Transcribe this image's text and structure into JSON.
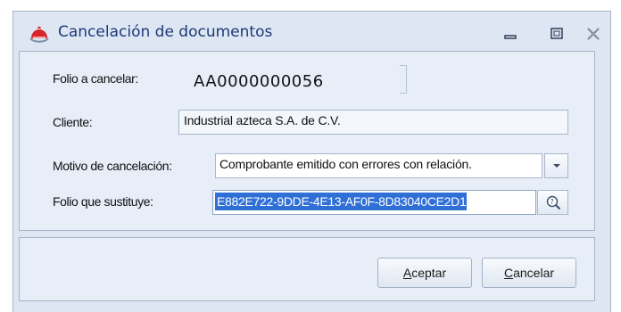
{
  "window": {
    "title": "Cancelación de documentos",
    "icon": "red-hat-icon"
  },
  "form": {
    "folio_label": "Folio a cancelar:",
    "folio_value": "AA0000000056",
    "cliente_label": "Cliente:",
    "cliente_value": "Industrial azteca S.A. de C.V.",
    "motivo_label": "Motivo de cancelación:",
    "motivo_value": "Comprobante emitido con errores con relación.",
    "sustituye_label": "Folio que sustituye:",
    "sustituye_value": "E882E722-9DDE-4E13-AF0F-8D83040CE2D1"
  },
  "buttons": {
    "aceptar_first": "A",
    "aceptar_rest": "ceptar",
    "cancelar_first": "C",
    "cancelar_rest": "ancelar"
  },
  "colors": {
    "title": "#1d3a78",
    "selection": "#2f6fd6",
    "window_bg": "#dde6f2"
  }
}
